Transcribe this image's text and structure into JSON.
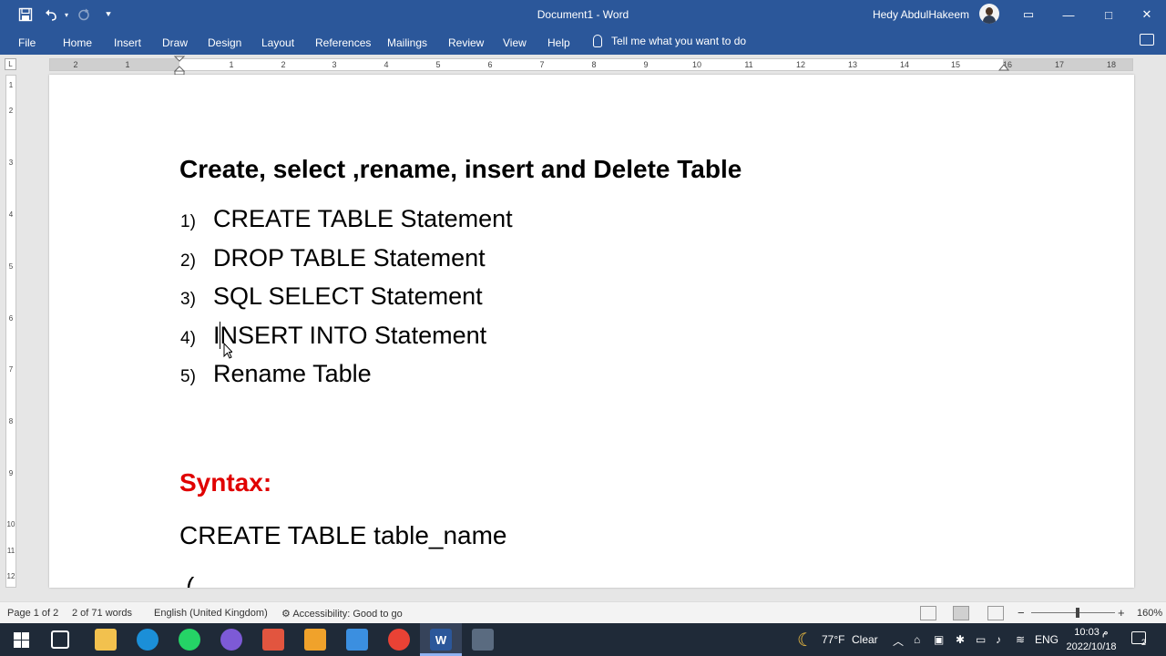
{
  "titlebar": {
    "doc_title": "Document1  -  Word",
    "user": "Hedy AbdulHakeem",
    "save_icon": "save-icon",
    "undo_icon": "undo-icon",
    "redo_icon": "redo-icon",
    "minimize": "—",
    "maximize": "□",
    "close": "✕",
    "ribbon_display": "▭"
  },
  "ribbon": {
    "tabs": [
      "File",
      "Home",
      "Insert",
      "Draw",
      "Design",
      "Layout",
      "References",
      "Mailings",
      "Review",
      "View",
      "Help"
    ],
    "tell_me": "Tell me what you want to do"
  },
  "ruler": {
    "corner": "L",
    "numbers": [
      "2",
      "1",
      "1",
      "2",
      "3",
      "4",
      "5",
      "6",
      "7",
      "8",
      "9",
      "10",
      "11",
      "12",
      "13",
      "14",
      "15",
      "16",
      "17",
      "18"
    ],
    "vnumbers": [
      "1",
      "2",
      "3",
      "4",
      "5",
      "6",
      "7",
      "8",
      "9",
      "10",
      "11",
      "12"
    ]
  },
  "document": {
    "heading": "Create, select ,rename, insert and Delete Table",
    "list": [
      {
        "num": "1)",
        "text": "CREATE TABLE Statement"
      },
      {
        "num": "2)",
        "text": "DROP TABLE Statement"
      },
      {
        "num": "3)",
        "text": "SQL SELECT Statement"
      },
      {
        "num": "4)",
        "text": "INSERT INTO Statement"
      },
      {
        "num": "5)",
        "text": "Rename Table"
      }
    ],
    "syntax_label": "Syntax:",
    "code_line": "CREATE TABLE table_name",
    "paren": "("
  },
  "statusbar": {
    "page": "Page 1 of 2",
    "words": "2 of 71 words",
    "language": "English (United Kingdom)",
    "accessibility": "Accessibility: Good to go",
    "zoom_minus": "−",
    "zoom_plus": "+",
    "zoom": "160%"
  },
  "taskbar": {
    "weather_temp": "77°F",
    "weather_text": "Clear",
    "lang": "ENG",
    "time": "10:03 م",
    "date": "2022/10/18",
    "notif_count": "2",
    "word_label": "W"
  },
  "colors": {
    "word_blue": "#2b579a",
    "syntax_red": "#e00000",
    "taskbar": "#1f2a38"
  }
}
